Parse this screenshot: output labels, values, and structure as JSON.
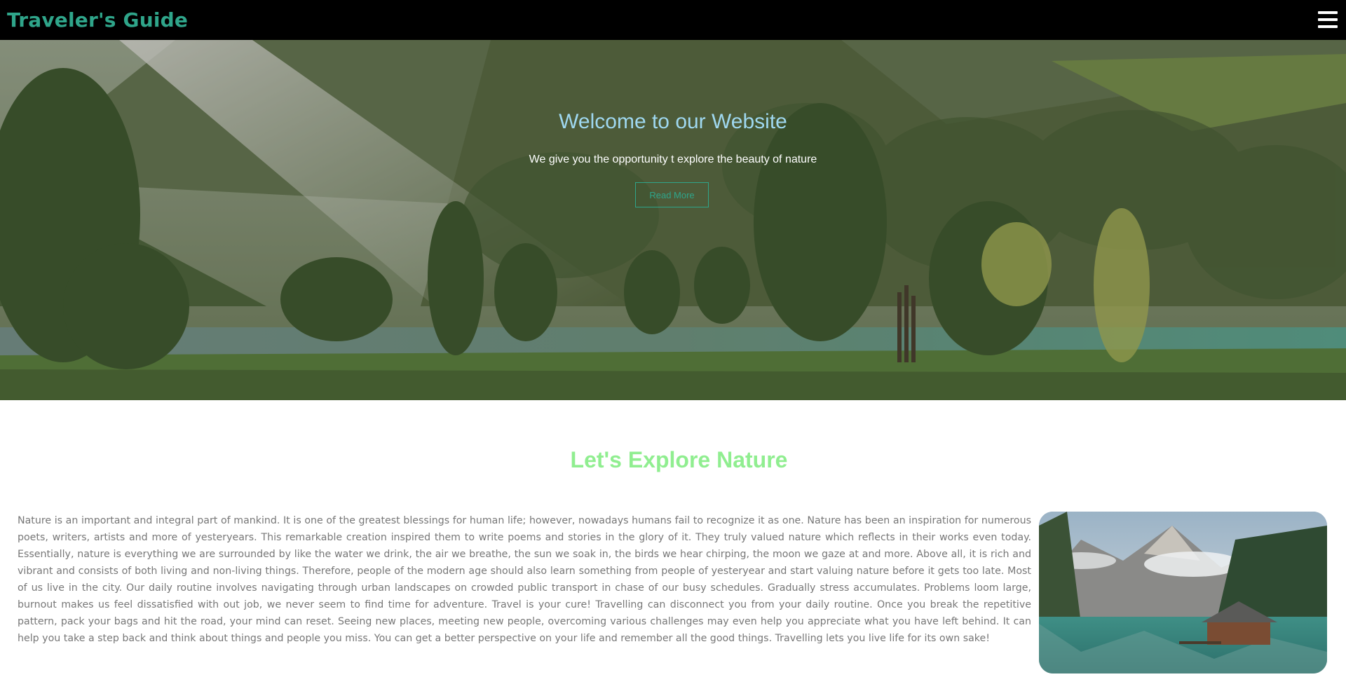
{
  "navbar": {
    "brand": "Traveler's Guide",
    "menu_icon": "hamburger-menu-icon"
  },
  "hero": {
    "title": "Welcome to our Website",
    "subtitle": "We give you the opportunity t explore the beauty of nature",
    "button_label": "Read More"
  },
  "section": {
    "title": "Let's Explore Nature",
    "paragraph": "Nature is an important and integral part of mankind. It is one of the greatest blessings for human life; however, nowadays humans fail to recognize it as one. Nature has been an inspiration for numerous poets, writers, artists and more of yesteryears. This remarkable creation inspired them to write poems and stories in the glory of it. They truly valued nature which reflects in their works even today. Essentially, nature is everything we are surrounded by like the water we drink, the air we breathe, the sun we soak in, the birds we hear chirping, the moon we gaze at and more. Above all, it is rich and vibrant and consists of both living and non-living things. Therefore, people of the modern age should also learn something from people of yesteryear and start valuing nature before it gets too late. Most of us live in the city. Our daily routine involves navigating through urban landscapes on crowded public transport in chase of our busy schedules. Gradually stress accumulates. Problems loom large, burnout makes us feel dissatisfied with out job, we never seem to find time for adventure. Travel is your cure! Travelling can disconnect you from your daily routine. Once you break the repetitive pattern, pack your bags and hit the road, your mind can reset. Seeing new places, meeting new people, overcoming various challenges may even help you appreciate what you have left behind. It can help you take a step back and think about things and people you miss. You can get a better perspective on your life and remember all the good things. Travelling lets you live life for its own sake!"
  },
  "colors": {
    "brand": "#2fa58a",
    "hero_title": "#9fd8f0",
    "section_title": "#90ee90",
    "body_text": "#777777",
    "navbar_bg": "#000000"
  }
}
